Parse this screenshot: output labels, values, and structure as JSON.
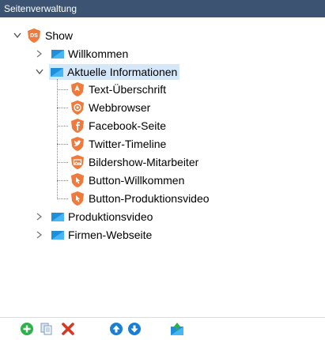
{
  "panel": {
    "title": "Seitenverwaltung"
  },
  "tree": {
    "root": {
      "label": "Show",
      "badge": "DS"
    },
    "folders": [
      {
        "label": "Willkommen",
        "expanded": false
      },
      {
        "label": "Aktuelle Informationen",
        "expanded": true,
        "selected": true,
        "children": [
          {
            "label": "Text-Überschrift",
            "icon": "text-module-icon"
          },
          {
            "label": "Webbrowser",
            "icon": "webbrowser-icon"
          },
          {
            "label": "Facebook-Seite",
            "icon": "facebook-icon"
          },
          {
            "label": "Twitter-Timeline",
            "icon": "twitter-icon"
          },
          {
            "label": "Bildershow-Mitarbeiter",
            "icon": "slideshow-icon"
          },
          {
            "label": "Button-Willkommen",
            "icon": "button-icon"
          },
          {
            "label": "Button-Produktionsvideo",
            "icon": "button-icon"
          }
        ]
      },
      {
        "label": "Produktionsvideo",
        "expanded": false
      },
      {
        "label": "Firmen-Webseite",
        "expanded": false
      }
    ]
  },
  "toolbar": {
    "buttons": [
      "add-icon",
      "copy-icon",
      "delete-icon",
      "move-up-icon",
      "move-down-icon",
      "import-icon"
    ]
  },
  "colors": {
    "titlebar": "#3c5471",
    "selection": "#d5e8fa",
    "folder": "#1f8fdc",
    "module_orange": "#f07a3c",
    "add_green": "#2db24a",
    "delete_red": "#d9371f",
    "move_blue": "#1a7fd4"
  }
}
